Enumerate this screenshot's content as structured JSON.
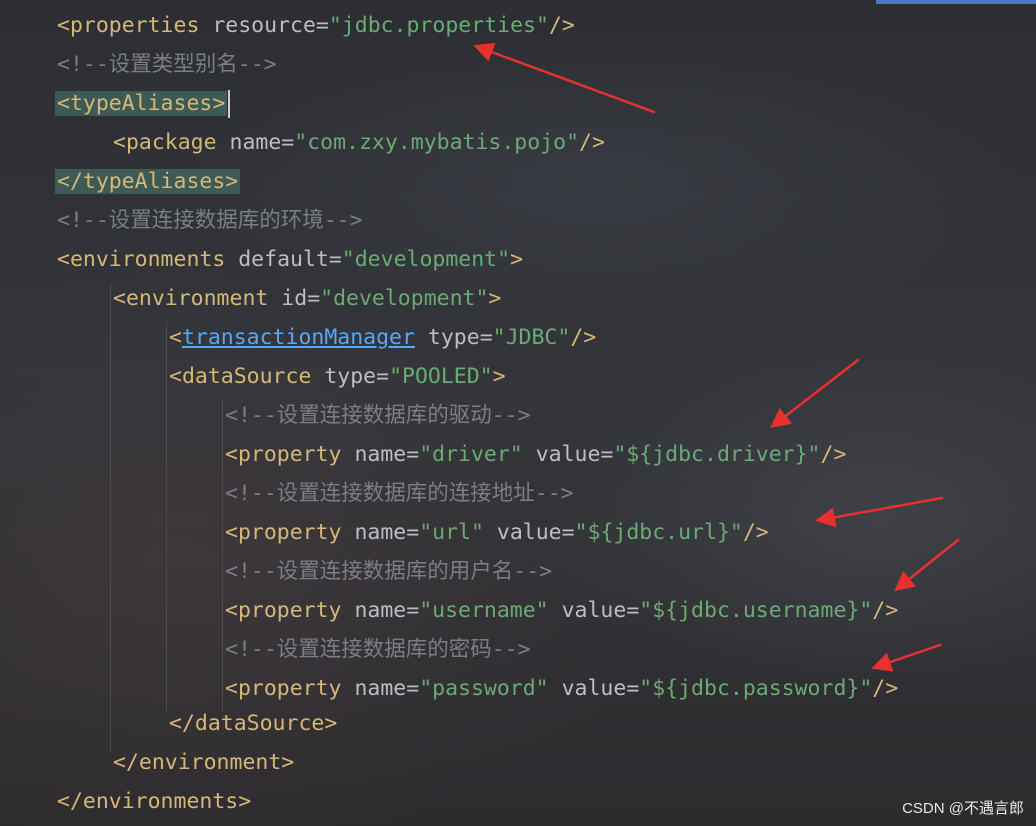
{
  "colors": {
    "tag": "#d5b778",
    "attribute": "#bcbec4",
    "value": "#6aab73",
    "comment": "#7a7e85",
    "link": "#56a8f5",
    "highlight": "#3d5a55",
    "arrow": "#e8312f"
  },
  "code": {
    "l1": {
      "open": "<properties",
      "a1": "resource",
      "v1": "\"jdbc.properties\"",
      "close": "/>"
    },
    "l2": {
      "comment": "<!--设置类型别名-->"
    },
    "l3": {
      "tag": "<typeAliases>"
    },
    "l4": {
      "open": "<package",
      "a1": "name",
      "v1": "\"com.zxy.mybatis.pojo\"",
      "close": "/>"
    },
    "l5": {
      "tag": "</typeAliases>"
    },
    "l6": {
      "comment": "<!--设置连接数据库的环境-->"
    },
    "l7": {
      "open": "<environments",
      "a1": "default",
      "v1": "\"development\"",
      "close": ">"
    },
    "l8": {
      "open": "<environment",
      "a1": "id",
      "v1": "\"development\"",
      "close": ">"
    },
    "l9": {
      "lt": "<",
      "name": "transactionManager",
      "a1": "type",
      "v1": "\"JDBC\"",
      "close": "/>"
    },
    "l10": {
      "open": "<dataSource",
      "a1": "type",
      "v1": "\"POOLED\"",
      "close": ">"
    },
    "l11": {
      "comment": "<!--设置连接数据库的驱动-->"
    },
    "l12": {
      "open": "<property",
      "a1": "name",
      "v1": "\"driver\"",
      "a2": "value",
      "v2": "\"${jdbc.driver}\"",
      "close": "/>"
    },
    "l13": {
      "comment": "<!--设置连接数据库的连接地址-->"
    },
    "l14": {
      "open": "<property",
      "a1": "name",
      "v1": "\"url\"",
      "a2": "value",
      "v2": "\"${jdbc.url}\"",
      "close": "/>"
    },
    "l15": {
      "comment": "<!--设置连接数据库的用户名-->"
    },
    "l16": {
      "open": "<property",
      "a1": "name",
      "v1": "\"username\"",
      "a2": "value",
      "v2": "\"${jdbc.username}\"",
      "close": "/>"
    },
    "l17": {
      "comment": "<!--设置连接数据库的密码-->"
    },
    "l18": {
      "open": "<property",
      "a1": "name",
      "v1": "\"password\"",
      "a2": "value",
      "v2": "\"${jdbc.password}\"",
      "close": "/>"
    },
    "l19": {
      "tag": "</dataSource>"
    },
    "l20": {
      "tag": "</environment>"
    },
    "l21": {
      "tag": "</environments>"
    }
  },
  "watermark": "CSDN @不遇言郎"
}
